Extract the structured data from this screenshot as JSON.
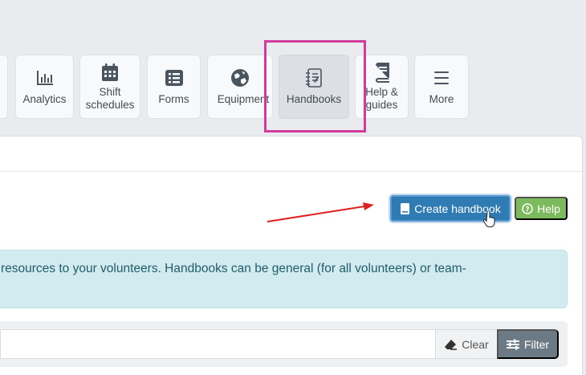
{
  "toolbar": {
    "items": [
      {
        "label": "Analytics",
        "icon": "bar-chart-icon"
      },
      {
        "label": "Shift\nschedules",
        "icon": "calendar-icon"
      },
      {
        "label": "Forms",
        "icon": "list-icon"
      },
      {
        "label": "Equipment",
        "icon": "globe-icon"
      },
      {
        "label": "Handbooks",
        "icon": "notebook-icon"
      },
      {
        "label": "Help &\nguides",
        "icon": "book-icon"
      },
      {
        "label": "More",
        "icon": "hamburger-icon"
      }
    ]
  },
  "actions": {
    "create_label": "Create handbook",
    "help_label": "Help"
  },
  "info": {
    "text": "resources to your volunteers. Handbooks can be general (for all volunteers) or team-"
  },
  "filter": {
    "clear_label": "Clear",
    "filter_label": "Filter"
  },
  "colors": {
    "highlight": "#d23a9b",
    "primary": "#2f7cb5",
    "help": "#7cba5e",
    "info_bg": "#d2ebef",
    "arrow": "#e02020"
  }
}
